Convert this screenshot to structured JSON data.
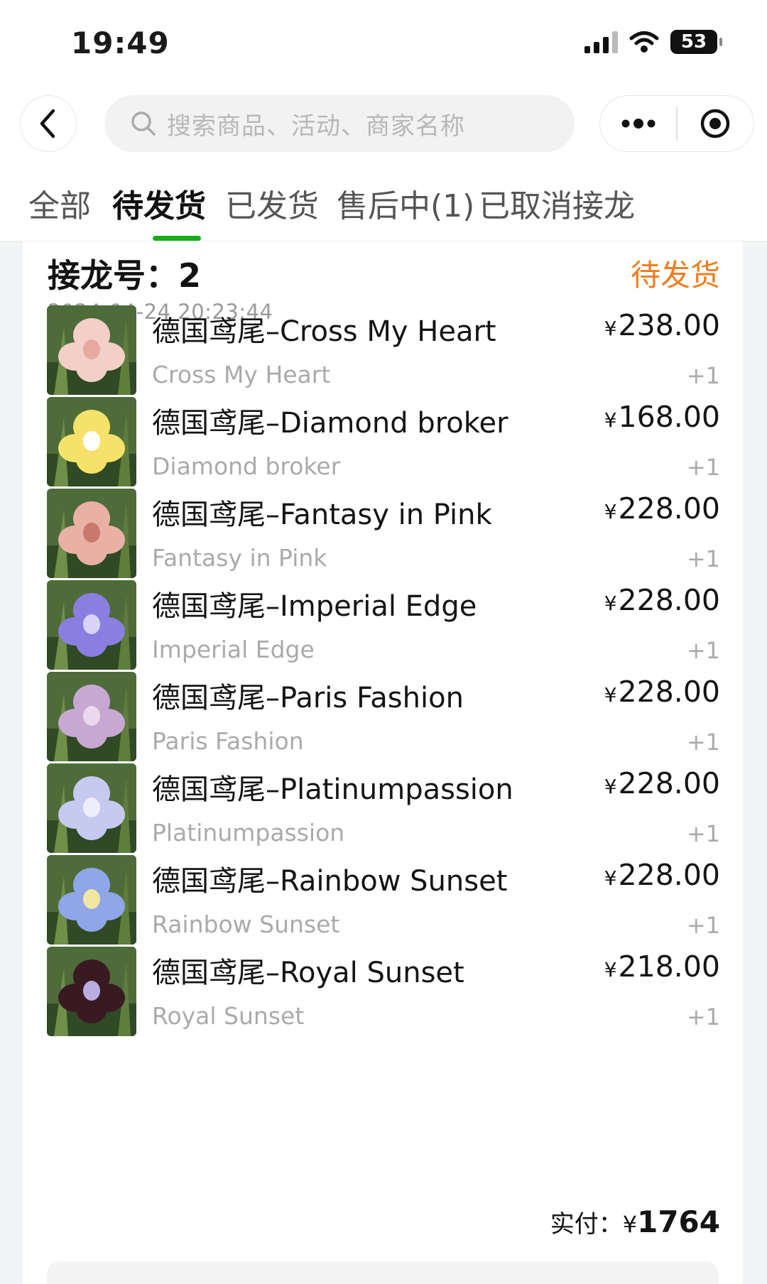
{
  "status_bar": {
    "time": "19:49",
    "battery": "53"
  },
  "search": {
    "placeholder": "搜索商品、活动、商家名称"
  },
  "tabs": [
    {
      "label": "全部"
    },
    {
      "label": "待发货"
    },
    {
      "label": "已发货"
    },
    {
      "label": "售后中(1)"
    },
    {
      "label": "已取消接龙"
    }
  ],
  "order": {
    "number_label": "接龙号：2",
    "status": "待发货",
    "time": "2024-04-24 20:23:44",
    "items": [
      {
        "name": "德国鸢尾–Cross My Heart",
        "subtitle": "Cross My Heart",
        "price": "238.00",
        "qty": "+1",
        "petal": "#f3cfc8",
        "center": "#e8a9a0"
      },
      {
        "name": "德国鸢尾–Diamond broker",
        "subtitle": "Diamond broker",
        "price": "168.00",
        "qty": "+1",
        "petal": "#f6e26a",
        "center": "#ffffff"
      },
      {
        "name": "德国鸢尾–Fantasy in Pink",
        "subtitle": "Fantasy in Pink",
        "price": "228.00",
        "qty": "+1",
        "petal": "#e9b1a4",
        "center": "#c9786c"
      },
      {
        "name": "德国鸢尾–Imperial Edge",
        "subtitle": "Imperial Edge",
        "price": "228.00",
        "qty": "+1",
        "petal": "#8a7fe0",
        "center": "#d9d4f7"
      },
      {
        "name": "德国鸢尾–Paris Fashion",
        "subtitle": "Paris Fashion",
        "price": "228.00",
        "qty": "+1",
        "petal": "#c9a7d3",
        "center": "#ead8ee"
      },
      {
        "name": "德国鸢尾–Platinumpassion",
        "subtitle": "Platinumpassion",
        "price": "228.00",
        "qty": "+1",
        "petal": "#c6caf0",
        "center": "#eceefc"
      },
      {
        "name": "德国鸢尾–Rainbow Sunset",
        "subtitle": "Rainbow Sunset",
        "price": "228.00",
        "qty": "+1",
        "petal": "#8fa6e8",
        "center": "#f2e7a0"
      },
      {
        "name": "德国鸢尾–Royal Sunset",
        "subtitle": "Royal Sunset",
        "price": "218.00",
        "qty": "+1",
        "petal": "#3a1a22",
        "center": "#b9aee0"
      }
    ],
    "currency": "¥",
    "total_label": "实付：",
    "total_value": "1764"
  },
  "colors": {
    "accent_green": "#19ad19",
    "status_orange": "#f07c1e"
  },
  "icons": [
    "signal-icon",
    "wifi-icon",
    "battery-icon",
    "back-chevron-icon",
    "search-icon",
    "more-dots-icon",
    "target-icon"
  ]
}
